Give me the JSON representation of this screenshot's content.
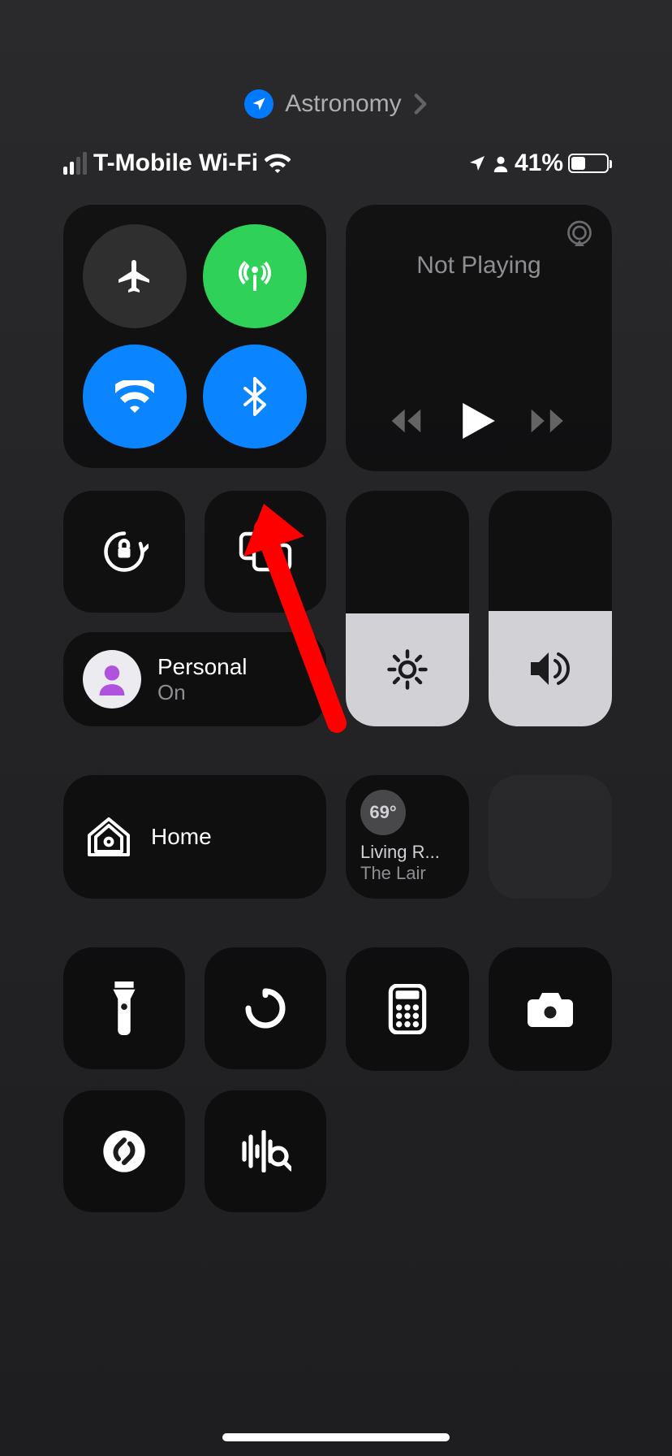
{
  "focus": {
    "app": "Astronomy"
  },
  "status": {
    "carrier": "T-Mobile Wi-Fi",
    "battery_pct": "41%",
    "battery_level": 41
  },
  "connectivity": {
    "airplane": false,
    "cellular": true,
    "wifi": true,
    "bluetooth": true
  },
  "media": {
    "title": "Not Playing"
  },
  "focus_mode": {
    "name": "Personal",
    "state": "On"
  },
  "sliders": {
    "brightness": 48,
    "volume": 49
  },
  "home": {
    "label": "Home"
  },
  "room": {
    "temp": "69°",
    "line1": "Living R...",
    "line2": "The Lair"
  }
}
